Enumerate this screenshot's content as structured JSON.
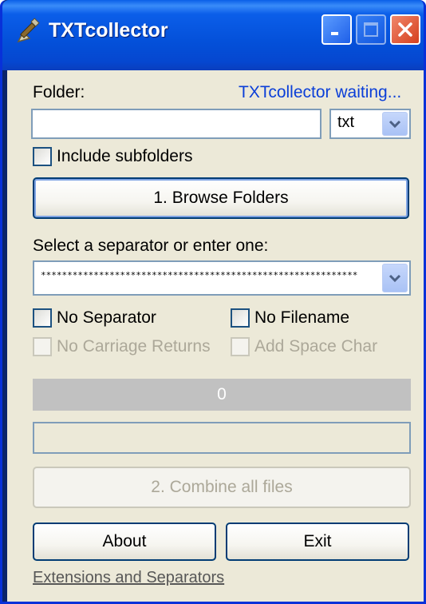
{
  "window": {
    "title": "TXTcollector",
    "icons": {
      "app": "broom-icon",
      "minimize": "minimize-icon",
      "maximize": "maximize-icon",
      "close": "close-icon"
    }
  },
  "folder": {
    "label": "Folder:",
    "status": "TXTcollector waiting...",
    "path_value": "",
    "extension": "txt",
    "include_subfolders_label": "Include subfolders"
  },
  "browse_button": "1. Browse Folders",
  "separator": {
    "label": "Select a separator or enter one:",
    "value": "************************************************************"
  },
  "options": {
    "no_separator": "No Separator",
    "no_filename": "No Filename",
    "no_carriage_returns": "No Carriage Returns",
    "add_space_char": "Add Space Char"
  },
  "progress": {
    "value_text": "0"
  },
  "combine_button": "2. Combine all files",
  "about_button": "About",
  "exit_button": "Exit",
  "footer_link": "Extensions and Separators",
  "colors": {
    "titlebar": "#0a56e0",
    "status_text": "#0b3fd8",
    "client_bg": "#ece9d8",
    "close_button": "#d5401e"
  }
}
